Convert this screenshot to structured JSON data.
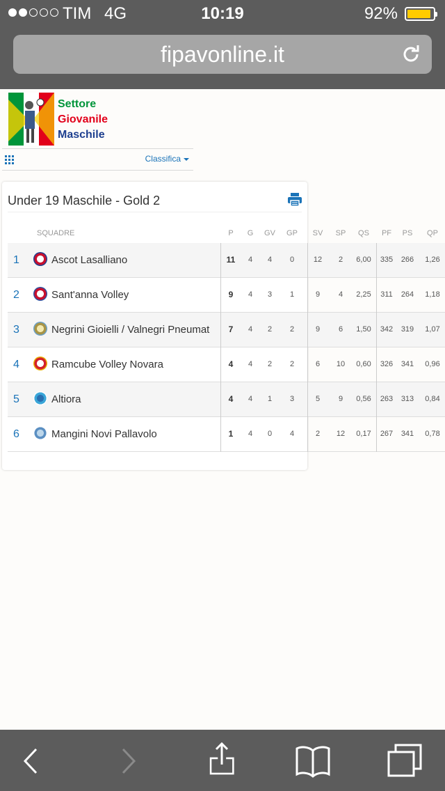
{
  "status_bar": {
    "signal_strength": 2,
    "signal_total": 5,
    "carrier": "TIM",
    "network": "4G",
    "time": "10:19",
    "battery_percent": "92%",
    "battery_level": 0.92,
    "battery_color": "#ffcc00"
  },
  "browser": {
    "url": "fipavonline.it",
    "reload_icon": "reload-icon"
  },
  "logo": {
    "lines": [
      "Settore",
      "Giovanile",
      "Maschile"
    ],
    "colors": [
      "#00953a",
      "#e2001a",
      "#1d3f8f"
    ]
  },
  "subnav": {
    "menu_icon": "grid-icon",
    "link_label": "Classifica"
  },
  "panel": {
    "title": "Under 19 Maschile - Gold 2",
    "print_icon": "print-icon"
  },
  "table": {
    "headers": {
      "team": "SQUADRE",
      "P": "P",
      "G": "G",
      "GV": "GV",
      "GP": "GP",
      "SV": "SV",
      "SP": "SP",
      "QS": "QS",
      "PF": "PF",
      "PS": "PS",
      "QP": "QP"
    },
    "rows": [
      {
        "rank": "1",
        "team": "Ascot Lasalliano",
        "P": "11",
        "G": "4",
        "GV": "4",
        "GP": "0",
        "SV": "12",
        "SP": "2",
        "QS": "6,00",
        "PF": "335",
        "PS": "266",
        "QP": "1,26"
      },
      {
        "rank": "2",
        "team": "Sant'anna Volley",
        "P": "9",
        "G": "4",
        "GV": "3",
        "GP": "1",
        "SV": "9",
        "SP": "4",
        "QS": "2,25",
        "PF": "311",
        "PS": "264",
        "QP": "1,18"
      },
      {
        "rank": "3",
        "team": "Negrini Gioielli / Valnegri Pneumat",
        "P": "7",
        "G": "4",
        "GV": "2",
        "GP": "2",
        "SV": "9",
        "SP": "6",
        "QS": "1,50",
        "PF": "342",
        "PS": "319",
        "QP": "1,07"
      },
      {
        "rank": "4",
        "team": "Ramcube Volley Novara",
        "P": "4",
        "G": "4",
        "GV": "2",
        "GP": "2",
        "SV": "6",
        "SP": "10",
        "QS": "0,60",
        "PF": "326",
        "PS": "341",
        "QP": "0,96"
      },
      {
        "rank": "5",
        "team": "Altiora",
        "P": "4",
        "G": "4",
        "GV": "1",
        "GP": "3",
        "SV": "5",
        "SP": "9",
        "QS": "0,56",
        "PF": "263",
        "PS": "313",
        "QP": "0,84"
      },
      {
        "rank": "6",
        "team": "Mangini Novi Pallavolo",
        "P": "1",
        "G": "4",
        "GV": "0",
        "GP": "4",
        "SV": "2",
        "SP": "12",
        "QS": "0,17",
        "PF": "267",
        "PS": "341",
        "QP": "0,78"
      }
    ]
  },
  "toolbar": {
    "items": [
      "back-icon",
      "forward-icon",
      "share-icon",
      "bookmarks-icon",
      "tabs-icon"
    ]
  },
  "accent_color": "#1a73b8"
}
